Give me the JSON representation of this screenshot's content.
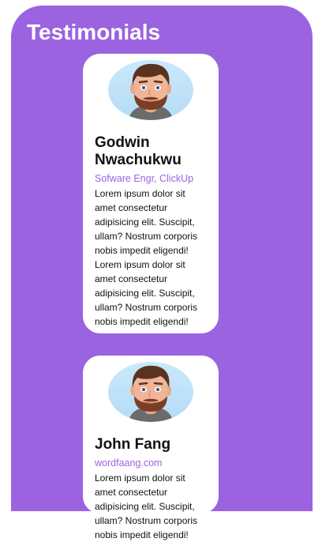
{
  "page": {
    "title": "Testimonials"
  },
  "testimonials": [
    {
      "name": "Godwin Nwachukwu",
      "role": "Sofware Engr, ClickUp",
      "quote": "Lorem ipsum dolor sit amet consectetur adipisicing elit. Suscipit, ullam? Nostrum corporis nobis impedit eligendi! Lorem ipsum dolor sit amet consectetur adipisicing elit. Suscipit, ullam? Nostrum corporis nobis impedit eligendi!",
      "avatar_icon": "man-avatar-icon"
    },
    {
      "name": "John Fang",
      "role": "wordfaang.com",
      "quote": "Lorem ipsum dolor sit amet consectetur adipisicing elit. Suscipit, ullam? Nostrum corporis nobis impedit eligendi!",
      "avatar_icon": "man-avatar-icon"
    }
  ],
  "colors": {
    "accent": "#9b63e0",
    "card": "#ffffff",
    "avatar_bg": "#c3e3f8"
  }
}
